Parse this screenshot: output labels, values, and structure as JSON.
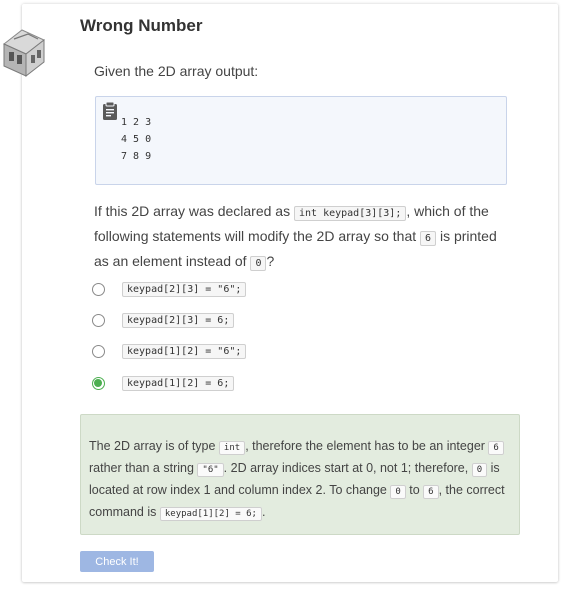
{
  "page": {
    "title": "Wrong Number",
    "prompt": "Given the 2D array output:",
    "output_lines": [
      "1 2 3",
      "4 5 0",
      "7 8 9"
    ],
    "question": {
      "p1": "If this 2D array was declared as ",
      "code1": "int keypad[3][3];",
      "p2": ", which of the following statements will modify the 2D array so that ",
      "code2": "6",
      "p3": " is printed as an element instead of ",
      "code3": "0",
      "p4": "?"
    },
    "options": [
      {
        "code": "keypad[2][3] = \"6\";",
        "selected": false
      },
      {
        "code": "keypad[2][3] = 6;",
        "selected": false
      },
      {
        "code": "keypad[1][2] = \"6\";",
        "selected": false
      },
      {
        "code": "keypad[1][2] = 6;",
        "selected": true
      }
    ],
    "feedback": {
      "t1": "The 2D array is of type ",
      "c1": "int",
      "t2": ", therefore the element has to be an integer ",
      "c2": "6",
      "t3": " rather than a string ",
      "c3": "\"6\"",
      "t4": ". 2D array indices start at 0, not 1; therefore, ",
      "c4": "0",
      "t5": " is located at row index 1 and column index 2. To change ",
      "c5": "0",
      "t6": " to ",
      "c6": "6",
      "t7": ", the correct command is ",
      "c7": "keypad[1][2] = 6;",
      "t8": "."
    },
    "check_button": "Check It!"
  },
  "colors": {
    "correct": "#4caf50",
    "feedback_bg": "#e3ecdf",
    "button_bg": "#9eb7e3",
    "codebox_bg": "#f4f7fc"
  },
  "icons": {
    "logo": "codio-logo-icon",
    "code": "clipboard-icon"
  }
}
